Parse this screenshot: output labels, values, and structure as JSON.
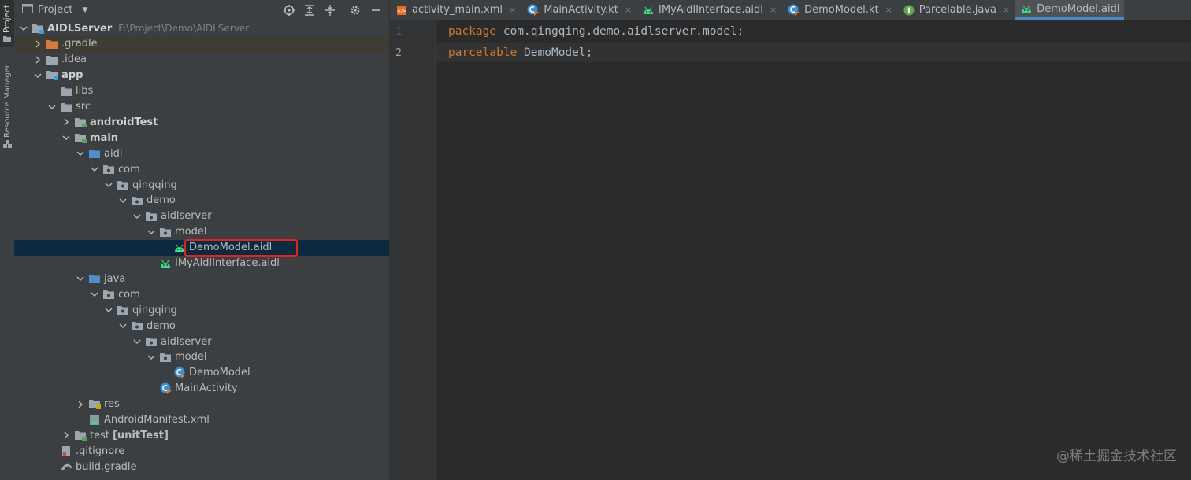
{
  "side_stripe": {
    "project_label": "Project",
    "resource_label": "Resource Manager"
  },
  "panel": {
    "title": "Project"
  },
  "tree": [
    {
      "label": "AIDLServer",
      "path": "F:\\Project\\Demo\\AIDLServer",
      "depth": 0,
      "expanded": true,
      "icon": "module-folder",
      "bold": true
    },
    {
      "label": ".gradle",
      "depth": 1,
      "expanded": false,
      "icon": "orange-folder"
    },
    {
      "label": ".idea",
      "depth": 1,
      "expanded": false,
      "icon": "folder"
    },
    {
      "label": "app",
      "depth": 1,
      "expanded": true,
      "icon": "module-folder",
      "bold": true
    },
    {
      "label": "libs",
      "depth": 2,
      "icon": "folder"
    },
    {
      "label": "src",
      "depth": 2,
      "expanded": true,
      "icon": "folder"
    },
    {
      "label": "androidTest",
      "depth": 3,
      "expanded": false,
      "icon": "source-folder",
      "bold": true
    },
    {
      "label": "main",
      "depth": 3,
      "expanded": true,
      "icon": "source-folder",
      "bold": true
    },
    {
      "label": "aidl",
      "depth": 4,
      "expanded": true,
      "icon": "blue-folder"
    },
    {
      "label": "com",
      "depth": 5,
      "expanded": true,
      "icon": "package-folder"
    },
    {
      "label": "qingqing",
      "depth": 6,
      "expanded": true,
      "icon": "package-folder"
    },
    {
      "label": "demo",
      "depth": 7,
      "expanded": true,
      "icon": "package-folder"
    },
    {
      "label": "aidlserver",
      "depth": 8,
      "expanded": true,
      "icon": "package-folder"
    },
    {
      "label": "model",
      "depth": 9,
      "expanded": true,
      "icon": "package-folder"
    },
    {
      "label": "DemoModel.aidl",
      "depth": 10,
      "icon": "android-icon",
      "selected": true
    },
    {
      "label": "IMyAidlInterface.aidl",
      "depth": 9,
      "icon": "android-icon"
    },
    {
      "label": "java",
      "depth": 4,
      "expanded": true,
      "icon": "blue-folder"
    },
    {
      "label": "com",
      "depth": 5,
      "expanded": true,
      "icon": "package-folder"
    },
    {
      "label": "qingqing",
      "depth": 6,
      "expanded": true,
      "icon": "package-folder"
    },
    {
      "label": "demo",
      "depth": 7,
      "expanded": true,
      "icon": "package-folder"
    },
    {
      "label": "aidlserver",
      "depth": 8,
      "expanded": true,
      "icon": "package-folder"
    },
    {
      "label": "model",
      "depth": 9,
      "expanded": true,
      "icon": "package-folder"
    },
    {
      "label": "DemoModel",
      "depth": 10,
      "icon": "kotlin-class-icon"
    },
    {
      "label": "MainActivity",
      "depth": 9,
      "icon": "kotlin-class-icon"
    },
    {
      "label": "res",
      "depth": 4,
      "expanded": false,
      "icon": "res-folder"
    },
    {
      "label": "AndroidManifest.xml",
      "depth": 4,
      "icon": "manifest-icon"
    },
    {
      "label": "test",
      "suffix": "[unitTest]",
      "depth": 3,
      "expanded": false,
      "icon": "source-folder"
    },
    {
      "label": ".gitignore",
      "depth": 2,
      "icon": "gitignore-icon"
    },
    {
      "label": "build.gradle",
      "depth": 2,
      "icon": "gradle-icon"
    }
  ],
  "tabs": [
    {
      "label": "activity_main.xml",
      "icon": "xml-icon"
    },
    {
      "label": "MainActivity.kt",
      "icon": "kotlin-class-icon"
    },
    {
      "label": "IMyAidlInterface.aidl",
      "icon": "android-icon"
    },
    {
      "label": "DemoModel.kt",
      "icon": "kotlin-class-icon"
    },
    {
      "label": "Parcelable.java",
      "icon": "interface-icon"
    },
    {
      "label": "DemoModel.aidl",
      "icon": "android-icon",
      "active": true
    }
  ],
  "code": [
    {
      "line": "1",
      "keyword": "package",
      "rest": " com.qingqing.demo.aidlserver.model;"
    },
    {
      "line": "2",
      "keyword": "parcelable",
      "rest": " DemoModel;"
    }
  ],
  "watermark": "@稀土掘金技术社区",
  "colors": {
    "selection": "#0d293e",
    "highlight_box": "#e0231f",
    "keyword": "#cc7832",
    "android_green": "#3ddc84"
  }
}
